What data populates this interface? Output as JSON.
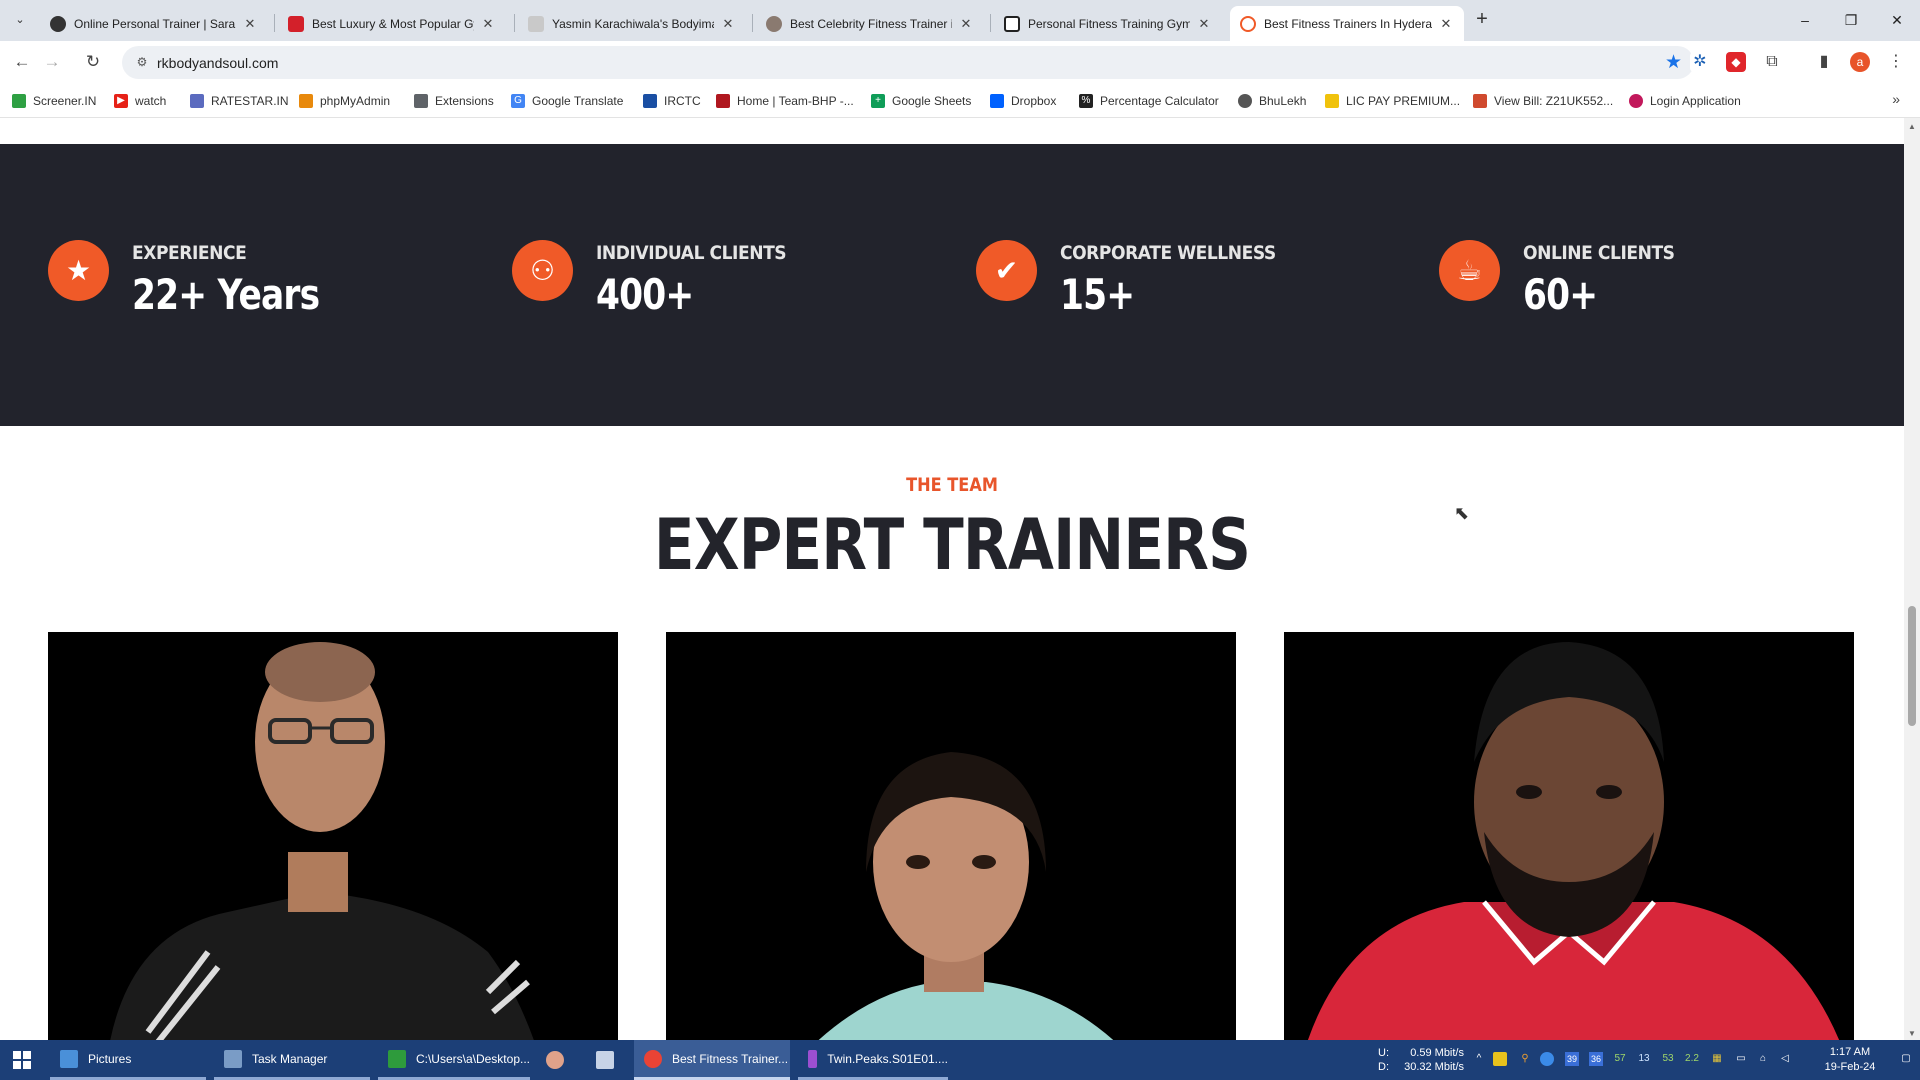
{
  "browser": {
    "tab_list_icon": "chevron-down-icon",
    "tabs": [
      {
        "title": "Online Personal Trainer | Sarah",
        "favicon_color": "#333333"
      },
      {
        "title": "Best Luxury & Most Popular Gym",
        "favicon_color": "#d3202a"
      },
      {
        "title": "Yasmin Karachiwala's Bodyimage",
        "favicon_color": "#bbbbbb"
      },
      {
        "title": "Best Celebrity Fitness Trainer in",
        "favicon_color": "#8a7a70"
      },
      {
        "title": "Personal Fitness Training Gym in",
        "favicon_color": "#222222"
      },
      {
        "title": "Best Fitness Trainers In Hyderabad",
        "favicon_color": "#f05a28"
      }
    ],
    "new_tab_label": "+",
    "window_controls": {
      "minimize": "–",
      "restore": "❐",
      "close": "✕"
    },
    "url": "rkbodyandsoul.com",
    "profile_initial": "a"
  },
  "bookmarks": [
    {
      "label": "Screener.IN",
      "color": "#2ea043"
    },
    {
      "label": "watch",
      "color": "#e62117"
    },
    {
      "label": "RATESTAR.IN",
      "color": "#5b6bbf"
    },
    {
      "label": "phpMyAdmin",
      "color": "#e8890c"
    },
    {
      "label": "Extensions",
      "color": "#5f6368"
    },
    {
      "label": "Google Translate",
      "color": "#4285f4"
    },
    {
      "label": "IRCTC",
      "color": "#1a4fa3"
    },
    {
      "label": "Home | Team-BHP -...",
      "color": "#b0171f"
    },
    {
      "label": "Google Sheets",
      "color": "#0f9d58"
    },
    {
      "label": "Dropbox",
      "color": "#0061fe"
    },
    {
      "label": "Percentage Calculator",
      "color": "#222222"
    },
    {
      "label": "BhuLekh",
      "color": "#555555"
    },
    {
      "label": "LIC PAY PREMIUM...",
      "color": "#f0c20c"
    },
    {
      "label": "View Bill: Z21UK552...",
      "color": "#d04a2e"
    },
    {
      "label": "Login Application",
      "color": "#c2185b"
    }
  ],
  "stats": [
    {
      "label": "EXPERIENCE",
      "value": "22+ Years",
      "icon": "star-icon"
    },
    {
      "label": "INDIVIDUAL CLIENTS",
      "value": "400+",
      "icon": "users-icon"
    },
    {
      "label": "CORPORATE WELLNESS",
      "value": "15+",
      "icon": "check-icon"
    },
    {
      "label": "ONLINE CLIENTS",
      "value": "60+",
      "icon": "coffee-cup-icon"
    }
  ],
  "team": {
    "eyebrow": "THE TEAM",
    "title": "EXPERT TRAINERS"
  },
  "accent_color": "#f05a28",
  "taskbar": {
    "items": [
      {
        "label": "Pictures",
        "color": "#4a90d9"
      },
      {
        "label": "Task Manager",
        "color": "#7a9cc6"
      },
      {
        "label": "C:\\Users\\a\\Desktop...",
        "color": "#2e9b3c"
      },
      {
        "label": "Best Fitness Trainer...",
        "color": "#ea4335"
      },
      {
        "label": "Twin.Peaks.S01E01....",
        "color": "#9c4fd1"
      }
    ],
    "network": {
      "up": "U:",
      "down": "D:",
      "up_rate": "0.59 Mbit/s",
      "down_rate": "30.32 Mbit/s"
    },
    "tray_numbers": [
      "39",
      "36",
      "57",
      "13",
      "53",
      "2.2"
    ],
    "time": "1:17 AM",
    "date": "19-Feb-24"
  }
}
